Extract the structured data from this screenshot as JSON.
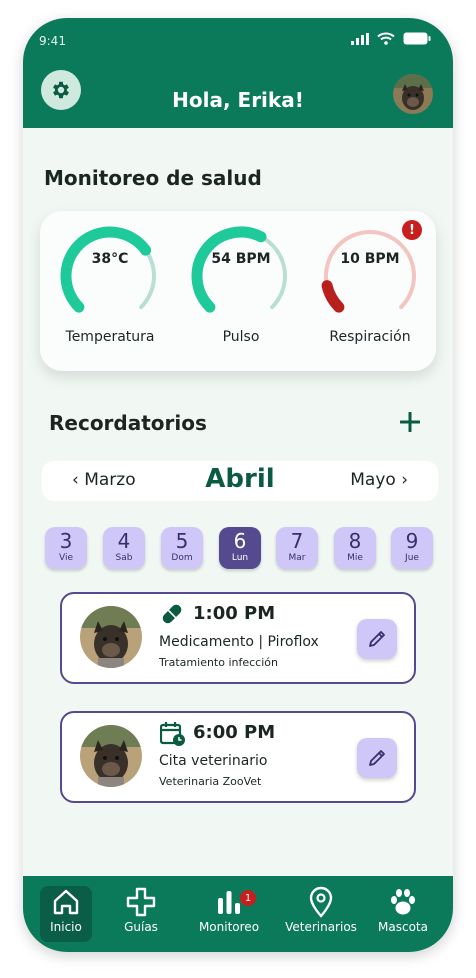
{
  "status_bar": {
    "time": "9:41"
  },
  "header": {
    "greeting": "Hola, Erika!"
  },
  "health": {
    "title": "Monitoreo de salud",
    "gauges": [
      {
        "value": "38°C",
        "label": "Temperatura",
        "level": 0.7,
        "color": "#1ec99a",
        "track": "#b8dfcf"
      },
      {
        "value": "54 BPM",
        "label": "Pulso",
        "level": 0.6,
        "color": "#1ec99a",
        "track": "#b8dfcf"
      },
      {
        "value": "10 BPM",
        "label": "Respiración",
        "level": 0.12,
        "color": "#b8201e",
        "track": "#f4c4c0",
        "alert": "!"
      }
    ]
  },
  "reminders": {
    "title": "Recordatorios",
    "add_label": "+",
    "months": {
      "prev": "‹ Marzo",
      "current": "Abril",
      "next": "Mayo ›"
    },
    "days": [
      {
        "num": "3",
        "name": "Vie"
      },
      {
        "num": "4",
        "name": "Sab"
      },
      {
        "num": "5",
        "name": "Dom"
      },
      {
        "num": "6",
        "name": "Lun",
        "active": true
      },
      {
        "num": "7",
        "name": "Mar"
      },
      {
        "num": "8",
        "name": "Mie"
      },
      {
        "num": "9",
        "name": "Jue"
      }
    ],
    "items": [
      {
        "icon": "pill-icon",
        "time": "1:00 PM",
        "title": "Medicamento | Piroflox",
        "subtitle": "Tratamiento infección"
      },
      {
        "icon": "calendar-clock-icon",
        "time": "6:00 PM",
        "title": "Cita veterinario",
        "subtitle": "Veterinaria ZooVet"
      }
    ]
  },
  "nav": [
    {
      "label": "Inicio",
      "icon": "home-icon",
      "active": true
    },
    {
      "label": "Guías",
      "icon": "cross-icon"
    },
    {
      "label": "Monitoreo",
      "icon": "bar-chart-icon",
      "badge": "1"
    },
    {
      "label": "Veterinarios",
      "icon": "location-pin-icon"
    },
    {
      "label": "Mascota",
      "icon": "paw-icon"
    }
  ],
  "colors": {
    "primary": "#0b7a5a",
    "accent": "#554a8f",
    "accent_light": "#cfc7f7",
    "alert": "#c81e1e"
  }
}
